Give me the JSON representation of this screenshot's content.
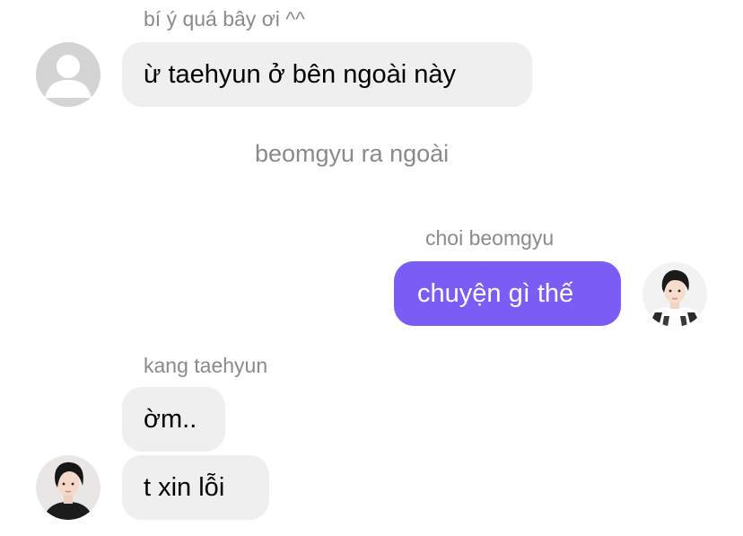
{
  "chat": {
    "group1": {
      "sender": "bí ý quá bây ơi ^^",
      "message": "ừ taehyun ở bên ngoài này",
      "avatar_icon": "default-user-avatar"
    },
    "system_message": "beomgyu ra ngoài",
    "group2": {
      "sender": "choi beomgyu",
      "message": "chuyện gì thế",
      "avatar_icon": "user-photo-avatar"
    },
    "group3": {
      "sender": "kang taehyun",
      "messages": [
        "ờm..",
        "t xin lỗi"
      ],
      "avatar_icon": "user-photo-avatar"
    }
  },
  "colors": {
    "outgoing_bubble": "#7b5cf5",
    "incoming_bubble": "#efefef",
    "meta_text": "#8a8a8e"
  }
}
